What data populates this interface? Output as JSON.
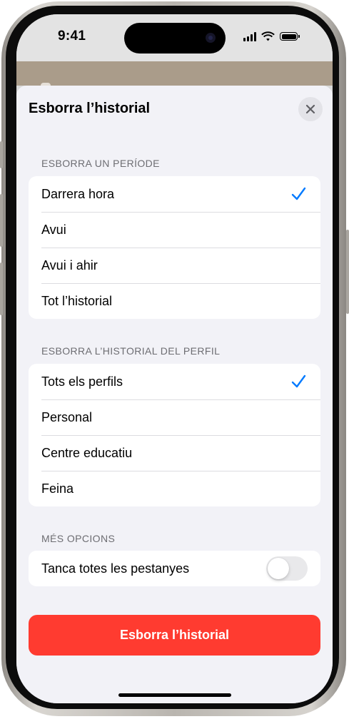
{
  "status_bar": {
    "time": "9:41",
    "icons": [
      "cellular-signal-icon",
      "wifi-icon",
      "battery-icon"
    ]
  },
  "sheet": {
    "title": "Esborra l’historial",
    "close_icon": "close-icon"
  },
  "period_section": {
    "header": "ESBORRA UN PERÍODE",
    "items": [
      {
        "label": "Darrera hora",
        "selected": true
      },
      {
        "label": "Avui",
        "selected": false
      },
      {
        "label": "Avui i ahir",
        "selected": false
      },
      {
        "label": "Tot l’historial",
        "selected": false
      }
    ]
  },
  "profile_section": {
    "header": "ESBORRA L’HISTORIAL DEL PERFIL",
    "items": [
      {
        "label": "Tots els perfils",
        "selected": true
      },
      {
        "label": "Personal",
        "selected": false
      },
      {
        "label": "Centre educatiu",
        "selected": false
      },
      {
        "label": "Feina",
        "selected": false
      }
    ]
  },
  "more_section": {
    "header": "MÉS OPCIONS",
    "close_tabs_label": "Tanca totes les pestanyes",
    "close_tabs_on": false
  },
  "primary_button": {
    "label": "Esborra l’historial"
  },
  "colors": {
    "accent": "#007aff",
    "destructive": "#ff3b30",
    "sheet_background": "#f2f2f7"
  }
}
